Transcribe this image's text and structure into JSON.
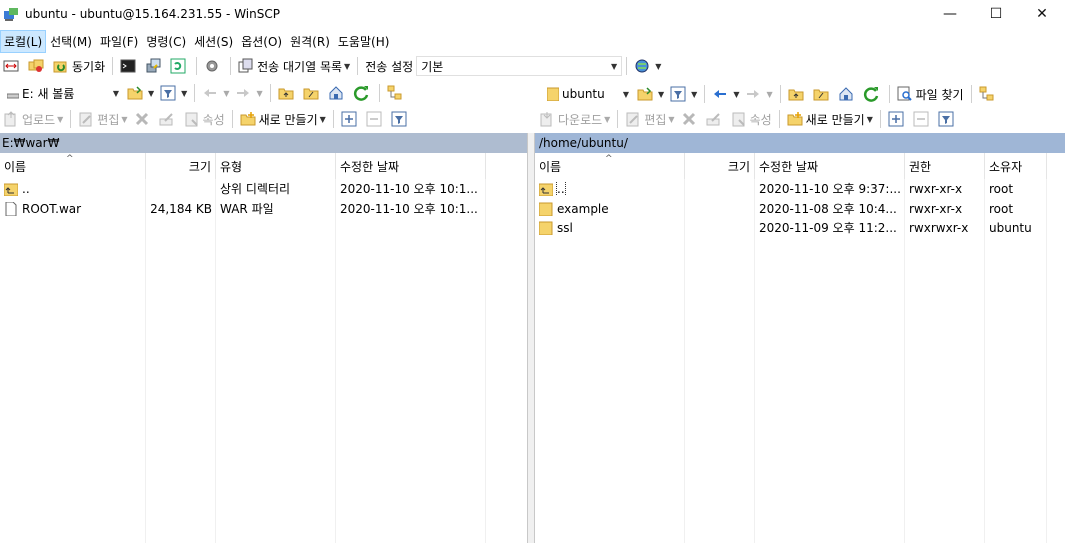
{
  "window": {
    "title": "ubuntu - ubuntu@15.164.231.55 - WinSCP",
    "minimize": "—",
    "maximize": "☐",
    "close": "✕"
  },
  "menu": [
    "로컬(L)",
    "선택(M)",
    "파일(F)",
    "명령(C)",
    "세션(S)",
    "옵션(O)",
    "원격(R)",
    "도움말(H)"
  ],
  "toolbar1": {
    "sync_label": "동기화",
    "transfer_queue_label": "전송 대기열 목록",
    "transfer_settings_label": "전송 설정",
    "transfer_settings_value": "기본"
  },
  "left": {
    "drive": "E: 새 볼륨",
    "upload_label": "업로드",
    "edit_label": "편집",
    "properties_label": "속성",
    "new_label": "새로 만들기",
    "path": "E:₩war₩",
    "columns": [
      "이름",
      "크기",
      "유형",
      "수정한 날짜"
    ],
    "rows": [
      {
        "name": "..",
        "size": "",
        "type": "상위 디렉터리",
        "date": "2020-11-10  오후 10:1...",
        "icon": "parent-dir"
      },
      {
        "name": "ROOT.war",
        "size": "24,184 KB",
        "type": "WAR 파일",
        "date": "2020-11-10  오후 10:1...",
        "icon": "file"
      }
    ]
  },
  "right": {
    "location": "ubuntu",
    "download_label": "다운로드",
    "edit_label": "편집",
    "properties_label": "속성",
    "new_label": "새로 만들기",
    "find_label": "파일 찾기",
    "path": "/home/ubuntu/",
    "columns": [
      "이름",
      "크기",
      "수정한 날짜",
      "권한",
      "소유자"
    ],
    "rows": [
      {
        "name": "..",
        "size": "",
        "date": "2020-11-10 오후 9:37:...",
        "rights": "rwxr-xr-x",
        "owner": "root",
        "icon": "parent-dir"
      },
      {
        "name": "example",
        "size": "",
        "date": "2020-11-08 오후 10:4...",
        "rights": "rwxr-xr-x",
        "owner": "root",
        "icon": "folder"
      },
      {
        "name": "ssl",
        "size": "",
        "date": "2020-11-09 오후 11:2...",
        "rights": "rwxrwxr-x",
        "owner": "ubuntu",
        "icon": "folder"
      }
    ]
  },
  "colors": {
    "path_left": "#aebcd0",
    "path_right": "#9fb6d6",
    "menu_active": "#cce8ff"
  }
}
